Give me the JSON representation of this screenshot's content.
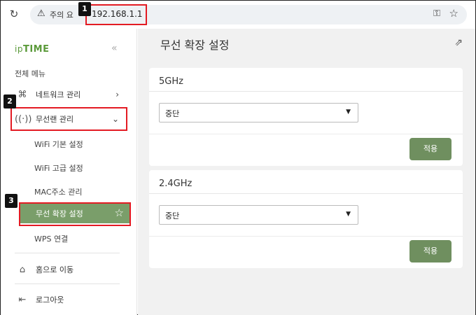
{
  "browser": {
    "warning_text": "주의 요",
    "url": "192.168.1.1"
  },
  "sidebar": {
    "logo_prefix": "ip",
    "logo_main": "TIME",
    "all_menu": "전체 메뉴",
    "network": "네트워크 관리",
    "wireless": "무선랜 관리",
    "sub_items": [
      "WiFi 기본 설정",
      "WiFi 고급 설정",
      "MAC주소 관리",
      "무선 확장 설정",
      "WPS 연결"
    ],
    "home": "홈으로 이동",
    "logout": "로그아웃"
  },
  "badges": [
    "1",
    "2",
    "3"
  ],
  "main": {
    "title": "무선 확장 설정",
    "cards": [
      {
        "band": "5GHz",
        "value": "중단",
        "apply": "적용"
      },
      {
        "band": "2.4GHz",
        "value": "중단",
        "apply": "적용"
      }
    ]
  },
  "colors": {
    "accent": "#7a9e6a",
    "apply_button": "#6f8f5f",
    "highlight": "#e31b23",
    "logo": "#5b9a3a"
  }
}
